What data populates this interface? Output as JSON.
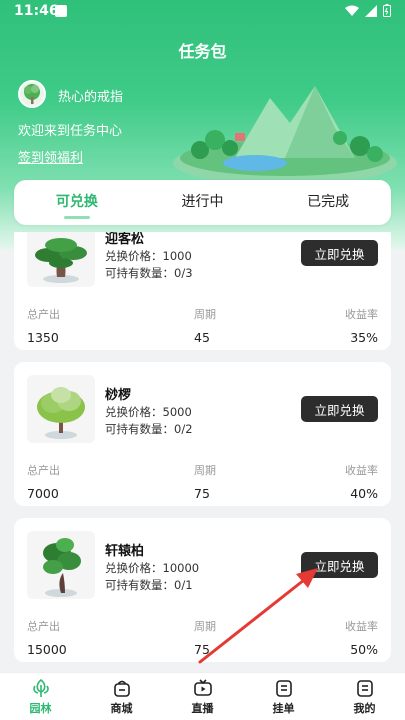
{
  "status_bar": {
    "time": "11:46"
  },
  "page": {
    "title": "任务包"
  },
  "user": {
    "name": "热心的戒指",
    "welcome": "欢迎来到任务中心",
    "signin_link": "签到领福利"
  },
  "tabs": [
    {
      "label": "可兑换",
      "active": true
    },
    {
      "label": "进行中",
      "active": false
    },
    {
      "label": "已完成",
      "active": false
    }
  ],
  "stat_labels": {
    "output": "总产出",
    "period": "周期",
    "yield": "收益率"
  },
  "items": [
    {
      "name": "迎客松",
      "price": "兑换价格：1000",
      "hold": "可持有数量：0/3",
      "button": "立即兑换",
      "output": "1350",
      "period": "45",
      "yield": "35%"
    },
    {
      "name": "桫椤",
      "price": "兑换价格：5000",
      "hold": "可持有数量：0/2",
      "button": "立即兑换",
      "output": "7000",
      "period": "75",
      "yield": "40%"
    },
    {
      "name": "轩辕柏",
      "price": "兑换价格：10000",
      "hold": "可持有数量：0/1",
      "button": "立即兑换",
      "output": "15000",
      "period": "75",
      "yield": "50%"
    }
  ],
  "bottom_nav": [
    {
      "label": "园林",
      "icon": "tree-icon",
      "active": true
    },
    {
      "label": "商城",
      "icon": "shop-bag-icon",
      "active": false
    },
    {
      "label": "直播",
      "icon": "tv-play-icon",
      "active": false
    },
    {
      "label": "挂单",
      "icon": "order-list-icon",
      "active": false
    },
    {
      "label": "我的",
      "icon": "profile-icon",
      "active": false
    }
  ],
  "colors": {
    "brand_green": "#2fb872",
    "button_dark": "#2d2d2d",
    "annotation_red": "#e53935"
  }
}
